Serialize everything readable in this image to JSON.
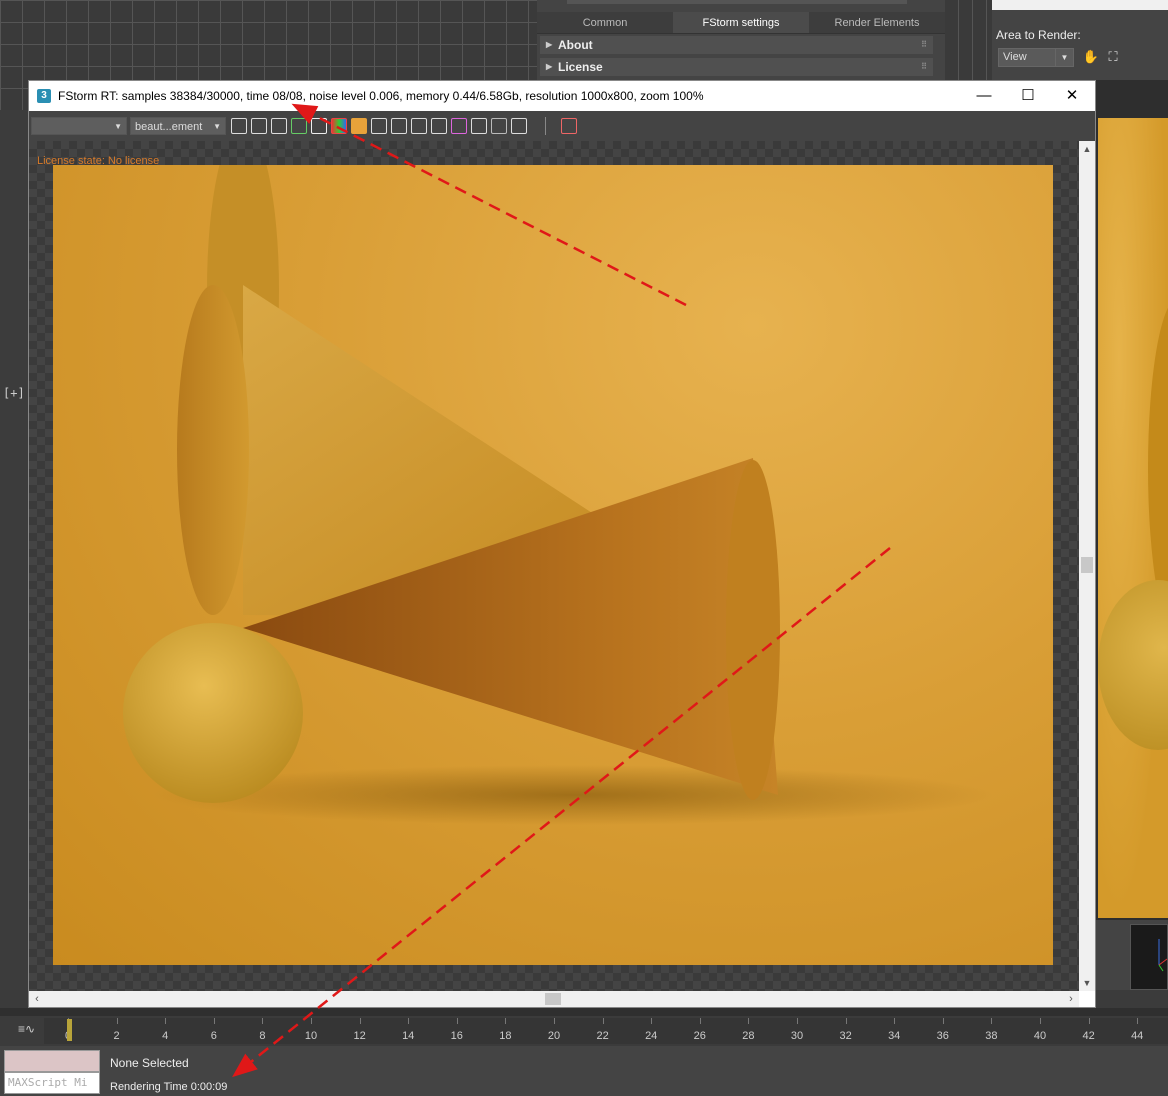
{
  "viewport": {
    "label": "[+]"
  },
  "render_setup": {
    "tabs": [
      {
        "label": "Common",
        "active": false
      },
      {
        "label": "FStorm settings",
        "active": true
      },
      {
        "label": "Render Elements",
        "active": false
      }
    ],
    "rollouts": [
      {
        "label": "About"
      },
      {
        "label": "License"
      }
    ]
  },
  "area_to_render": {
    "label": "Area to Render:",
    "value": "View"
  },
  "render_window": {
    "title": "FStorm RT: samples 38384/30000,  time 08/08,  noise level 0.006,  memory 0.44/6.58Gb,  resolution 1000x800,  zoom 100%",
    "app_icon": "3",
    "minimize": "—",
    "maximize": "☐",
    "close": "✕",
    "channel_select": "",
    "element_select": "beaut...ement",
    "license_state": "License state: No license",
    "toolbar_icons": [
      "save-image-icon",
      "save-icon",
      "copy-icon",
      "refresh-icon",
      "clone-icon",
      "color-channels-icon",
      "pause-icon",
      "region-icon",
      "frame-icon",
      "crop-icon",
      "exposure-icon",
      "color-picker-icon",
      "zoom-icon",
      "alpha-icon",
      "settings-icon",
      "rerender-icon"
    ]
  },
  "timeline": {
    "ticks": [
      "0",
      "2",
      "4",
      "6",
      "8",
      "10",
      "12",
      "14",
      "16",
      "18",
      "20",
      "22",
      "24",
      "26",
      "28",
      "30",
      "32",
      "34",
      "36",
      "38",
      "40",
      "42",
      "44"
    ]
  },
  "status": {
    "selection": "None Selected",
    "render_time": "Rendering Time  0:00:09",
    "maxscript_placeholder": "MAXScript Mi"
  },
  "colors": {
    "accent_orange": "#d87b2a",
    "annotation_red": "#e01818",
    "render_bg": "#d99e36"
  }
}
